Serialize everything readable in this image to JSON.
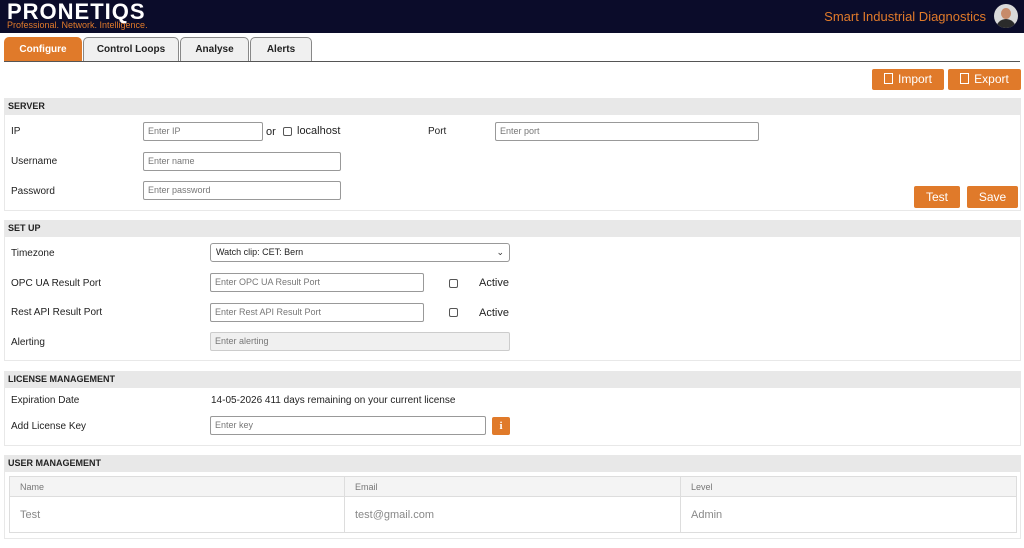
{
  "header": {
    "logo": "PRONETIQS",
    "tagline": "Professional. Network. Intelligence.",
    "app_title": "Smart Industrial Diagnostics"
  },
  "tabs": [
    {
      "label": "Configure",
      "active": true
    },
    {
      "label": "Control Loops",
      "active": false
    },
    {
      "label": "Analyse",
      "active": false
    },
    {
      "label": "Alerts",
      "active": false
    }
  ],
  "toolbar": {
    "import_label": "Import",
    "export_label": "Export"
  },
  "server": {
    "title": "SERVER",
    "ip_label": "IP",
    "ip_placeholder": "Enter IP",
    "or_label": "or",
    "localhost_label": "localhost",
    "port_label": "Port",
    "port_placeholder": "Enter port",
    "username_label": "Username",
    "username_placeholder": "Enter name",
    "password_label": "Password",
    "password_placeholder": "Enter password",
    "test_label": "Test",
    "save_label": "Save"
  },
  "setup": {
    "title": "SET UP",
    "timezone_label": "Timezone",
    "timezone_value": "Watch clip: CET: Bern",
    "opc_label": "OPC UA Result Port",
    "opc_placeholder": "Enter OPC UA Result Port",
    "opc_active_label": "Active",
    "rest_label": "Rest API Result Port",
    "rest_placeholder": "Enter Rest API Result Port",
    "rest_active_label": "Active",
    "alerting_label": "Alerting",
    "alerting_placeholder": "Enter alerting"
  },
  "license": {
    "title": "LICENSE MANAGEMENT",
    "expiration_label": "Expiration Date",
    "expiration_value": "14-05-2026 411 days remaining on your current license",
    "key_label": "Add License Key",
    "key_placeholder": "Enter key",
    "info_icon": "i"
  },
  "users": {
    "title": "USER MANAGEMENT",
    "columns": [
      "Name",
      "Email",
      "Level"
    ],
    "rows": [
      [
        "Test",
        "test@gmail.com",
        "Admin"
      ]
    ]
  },
  "colors": {
    "accent": "#e07a2a",
    "topbar": "#0b0c2a"
  }
}
